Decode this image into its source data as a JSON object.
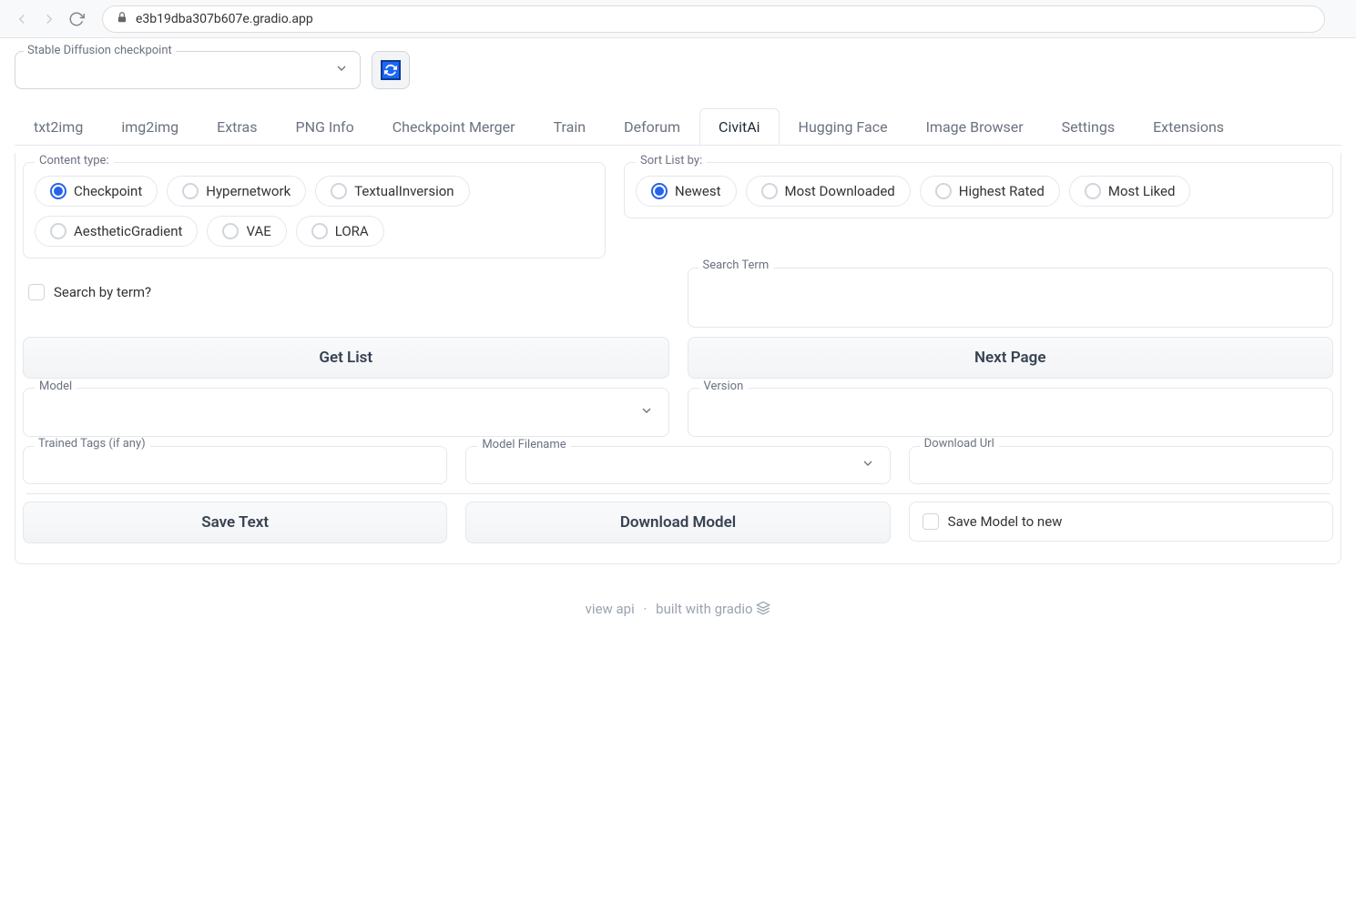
{
  "browser": {
    "url": "e3b19dba307b607e.gradio.app"
  },
  "header": {
    "checkpoint_label": "Stable Diffusion checkpoint"
  },
  "tabs": [
    {
      "label": "txt2img",
      "active": false
    },
    {
      "label": "img2img",
      "active": false
    },
    {
      "label": "Extras",
      "active": false
    },
    {
      "label": "PNG Info",
      "active": false
    },
    {
      "label": "Checkpoint Merger",
      "active": false
    },
    {
      "label": "Train",
      "active": false
    },
    {
      "label": "Deforum",
      "active": false
    },
    {
      "label": "CivitAi",
      "active": true
    },
    {
      "label": "Hugging Face",
      "active": false
    },
    {
      "label": "Image Browser",
      "active": false
    },
    {
      "label": "Settings",
      "active": false
    },
    {
      "label": "Extensions",
      "active": false
    }
  ],
  "content_type": {
    "label": "Content type:",
    "options": [
      {
        "label": "Checkpoint",
        "selected": true
      },
      {
        "label": "Hypernetwork",
        "selected": false
      },
      {
        "label": "TextualInversion",
        "selected": false
      },
      {
        "label": "AestheticGradient",
        "selected": false
      },
      {
        "label": "VAE",
        "selected": false
      },
      {
        "label": "LORA",
        "selected": false
      }
    ]
  },
  "sort_by": {
    "label": "Sort List by:",
    "options": [
      {
        "label": "Newest",
        "selected": true
      },
      {
        "label": "Most Downloaded",
        "selected": false
      },
      {
        "label": "Highest Rated",
        "selected": false
      },
      {
        "label": "Most Liked",
        "selected": false
      }
    ]
  },
  "search": {
    "checkbox_label": "Search by term?",
    "term_label": "Search Term"
  },
  "buttons": {
    "get_list": "Get List",
    "next_page": "Next Page",
    "save_text": "Save Text",
    "download_model": "Download Model",
    "save_model_new": "Save Model to new"
  },
  "fields": {
    "model": "Model",
    "version": "Version",
    "trained_tags": "Trained Tags (if any)",
    "model_filename": "Model Filename",
    "download_url": "Download Url"
  },
  "footer": {
    "view_api": "view api",
    "built_with": "built with gradio"
  }
}
